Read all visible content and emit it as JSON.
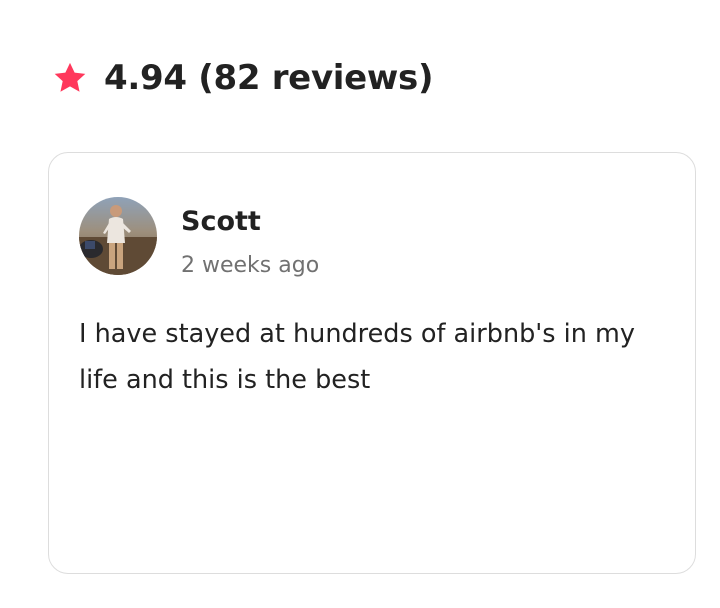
{
  "header": {
    "rating_summary": "4.94 (82 reviews)",
    "star_icon": "star-icon",
    "star_color": "#FF385C"
  },
  "review": {
    "reviewer_name": "Scott",
    "date": "2 weeks ago",
    "text": "I have stayed at hundreds of airbnb's in my life and this is the best",
    "avatar_icon": "avatar"
  },
  "colors": {
    "text_primary": "#222222",
    "text_secondary": "#717171",
    "card_border": "#DDDDDD",
    "accent": "#FF385C"
  }
}
